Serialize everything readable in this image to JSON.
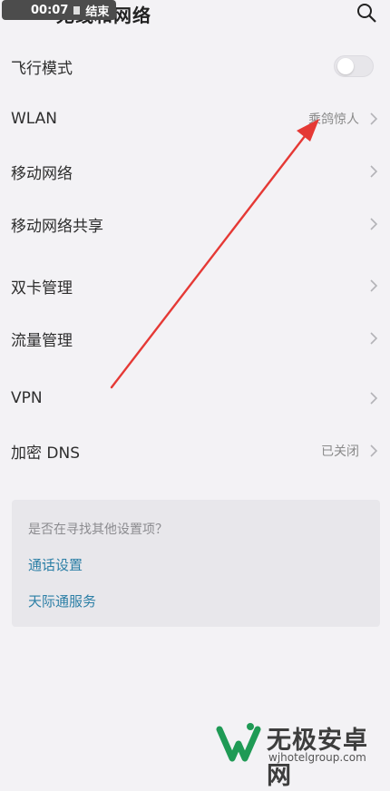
{
  "header": {
    "title": "无线和网络",
    "rec_time": "00:07",
    "rec_end": "结束"
  },
  "rows": [
    {
      "label": "飞行模式",
      "control": "toggle",
      "toggle_on": false
    },
    {
      "label": "WLAN",
      "value": "乘鸽惊人"
    },
    {
      "label": "移动网络"
    },
    {
      "label": "移动网络共享"
    },
    {
      "label": "双卡管理"
    },
    {
      "label": "流量管理"
    },
    {
      "label": "VPN"
    },
    {
      "label": "加密 DNS",
      "value": "已关闭"
    }
  ],
  "suggest": {
    "title": "是否在寻找其他设置项？",
    "links": [
      "通话设置",
      "天际通服务"
    ]
  },
  "watermark": {
    "name": "无极安卓网",
    "url": "wjhotelgroup.com"
  },
  "colors": {
    "link": "#2c7fa6",
    "arrow": "#e53935",
    "background": "#f3f2f5"
  }
}
